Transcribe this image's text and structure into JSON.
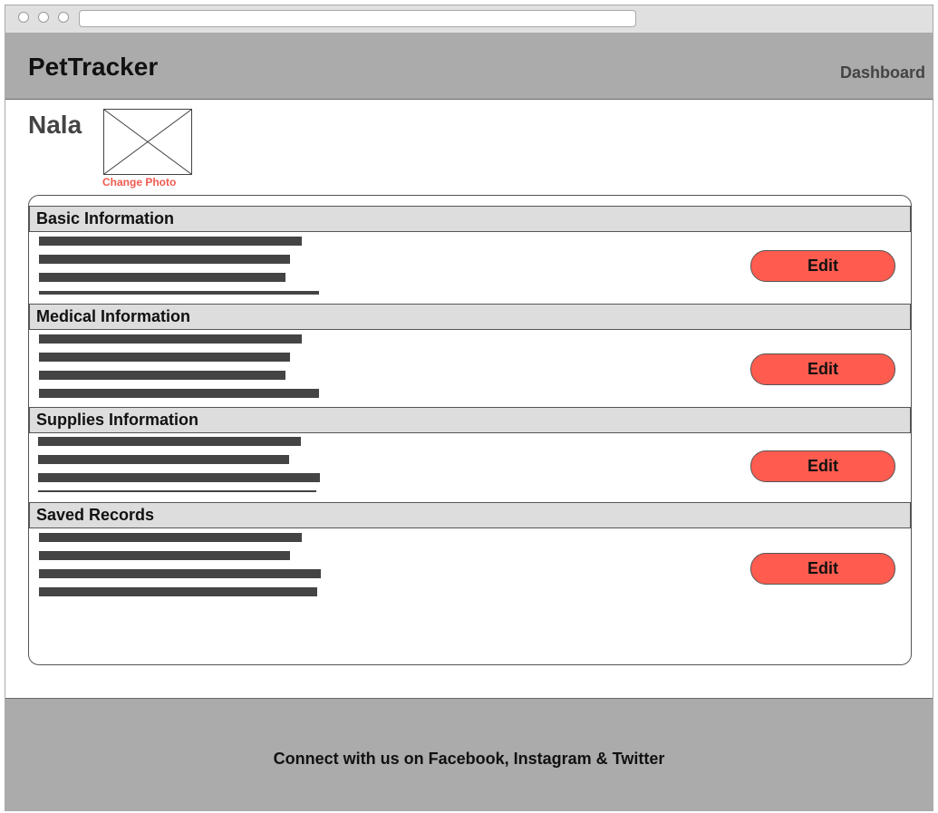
{
  "header": {
    "brand": "PetTracker",
    "nav_dashboard": "Dashboard"
  },
  "pet": {
    "name": "Nala",
    "change_photo_label": "Change Photo"
  },
  "sections": [
    {
      "title": "Basic Information",
      "edit_label": "Edit"
    },
    {
      "title": "Medical Information",
      "edit_label": "Edit"
    },
    {
      "title": "Supplies Information",
      "edit_label": "Edit"
    },
    {
      "title": "Saved Records",
      "edit_label": "Edit"
    }
  ],
  "footer": {
    "text": "Connect with us on Facebook, Instagram & Twitter"
  },
  "colors": {
    "accent": "#ff5c4f",
    "link": "#f05a4f",
    "header_bg": "#ababab",
    "section_header_bg": "#dddddd"
  },
  "icons": {
    "photo_placeholder": "image-placeholder-icon"
  }
}
